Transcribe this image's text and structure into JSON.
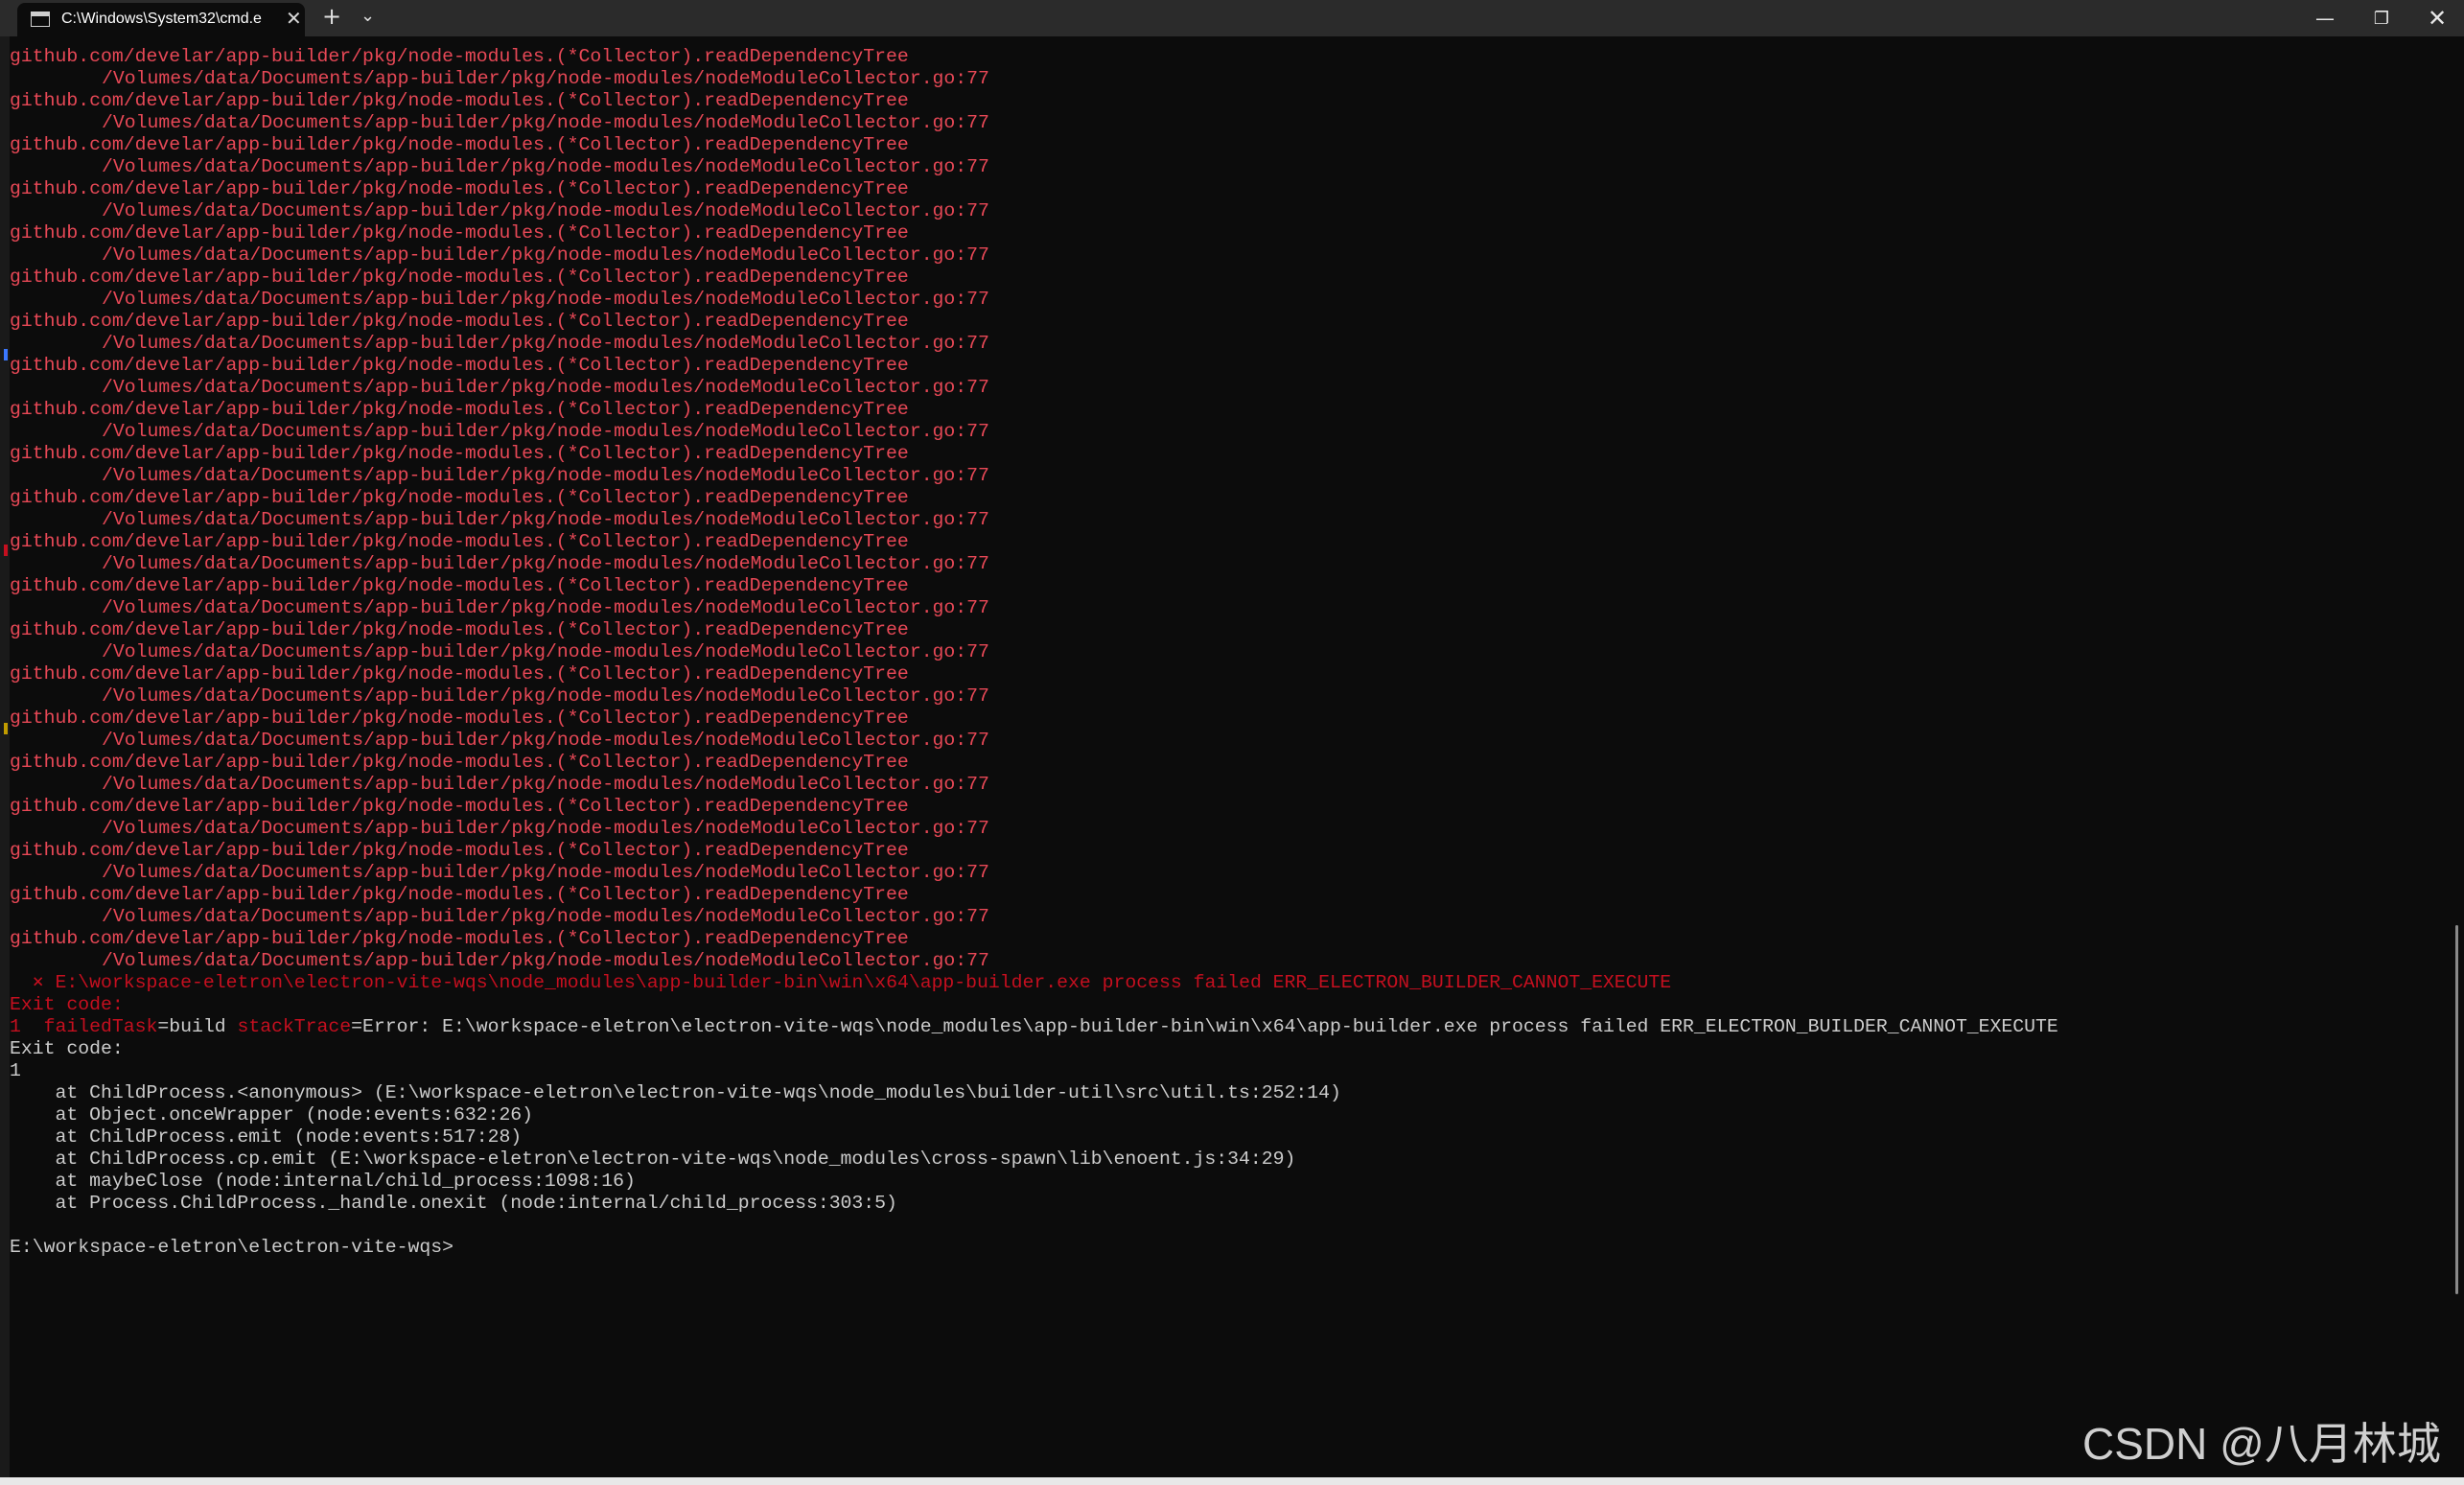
{
  "tab": {
    "title": "C:\\Windows\\System32\\cmd.e",
    "new_tab_label": "+",
    "dropdown_label": "⌄",
    "close_label": "✕"
  },
  "window_controls": {
    "minimize": "—",
    "maximize": "❐",
    "close": "✕"
  },
  "trace": {
    "repeat_count": 21,
    "func_line": "github.com/develar/app-builder/pkg/node-modules.(*Collector).readDependencyTree",
    "file_line": "/Volumes/data/Documents/app-builder/pkg/node-modules/nodeModuleCollector.go:77"
  },
  "error": {
    "x_line": "  ⨯ E:\\workspace-eletron\\electron-vite-wqs\\node_modules\\app-builder-bin\\win\\x64\\app-builder.exe process failed ERR_ELECTRON_BUILDER_CANNOT_EXECUTE",
    "exit_code_red": "Exit code:",
    "one_red": "1",
    "failed_task_key": "failedTask",
    "failed_task_val": "=build ",
    "stack_trace_key": "stackTrace",
    "stack_trace_val": "=Error: E:\\workspace-eletron\\electron-vite-wqs\\node_modules\\app-builder-bin\\win\\x64\\app-builder.exe process failed ERR_ELECTRON_BUILDER_CANNOT_EXECUTE",
    "exit_code_white": "Exit code:",
    "one_white": "1"
  },
  "stack": [
    "    at ChildProcess.<anonymous> (E:\\workspace-eletron\\electron-vite-wqs\\node_modules\\builder-util\\src\\util.ts:252:14)",
    "    at Object.onceWrapper (node:events:632:26)",
    "    at ChildProcess.emit (node:events:517:28)",
    "    at ChildProcess.cp.emit (E:\\workspace-eletron\\electron-vite-wqs\\node_modules\\cross-spawn\\lib\\enoent.js:34:29)",
    "    at maybeClose (node:internal/child_process:1098:16)",
    "    at Process.ChildProcess._handle.onexit (node:internal/child_process:303:5)"
  ],
  "prompt": "E:\\workspace-eletron\\electron-vite-wqs>",
  "watermark": "CSDN @八月林城",
  "colors": {
    "trace_red": "#e74856",
    "error_red": "#c50f1f",
    "text_white": "#cccccc",
    "background": "#0c0c0c"
  }
}
